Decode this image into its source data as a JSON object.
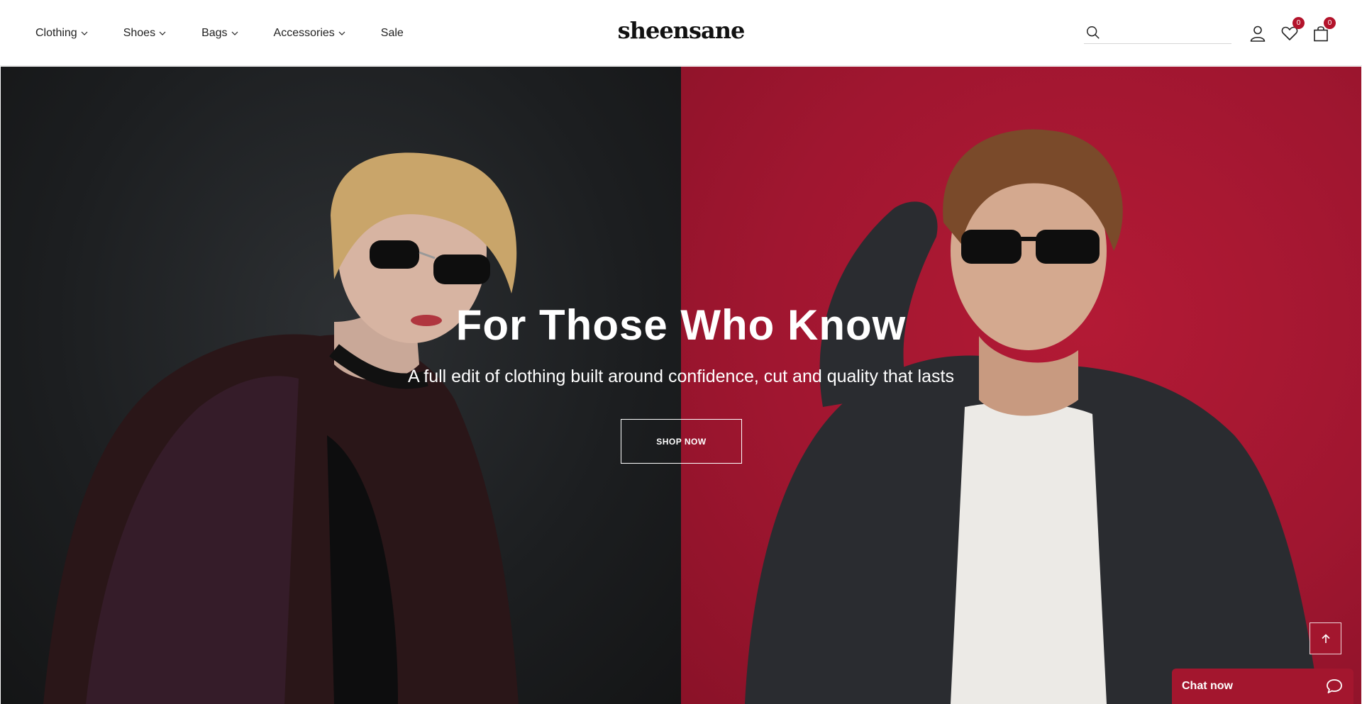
{
  "nav": {
    "items": [
      {
        "label": "Clothing",
        "has_dropdown": true
      },
      {
        "label": "Shoes",
        "has_dropdown": true
      },
      {
        "label": "Bags",
        "has_dropdown": true
      },
      {
        "label": "Accessories",
        "has_dropdown": true
      },
      {
        "label": "Sale",
        "has_dropdown": false
      }
    ]
  },
  "brand": {
    "logo_text": "sheensane"
  },
  "header": {
    "search": {
      "value": "",
      "placeholder": "",
      "icon": "search-icon"
    },
    "account_icon": "user-icon",
    "wishlist": {
      "icon": "heart-icon",
      "count": "0"
    },
    "cart": {
      "icon": "bag-icon",
      "count": "0"
    }
  },
  "hero": {
    "title": "For Those Who Know",
    "subtitle": "A full edit of clothing built around confidence, cut and quality that lasts",
    "cta_label": "SHOP NOW",
    "left_bg": "#1c1e20",
    "right_bg": "#a31731"
  },
  "scroll_top": {
    "icon": "arrow-up-icon"
  },
  "chat": {
    "label": "Chat now",
    "icon": "chat-bubble-icon"
  },
  "colors": {
    "accent": "#a3162e",
    "badge": "#b3132b",
    "text": "#222222"
  }
}
